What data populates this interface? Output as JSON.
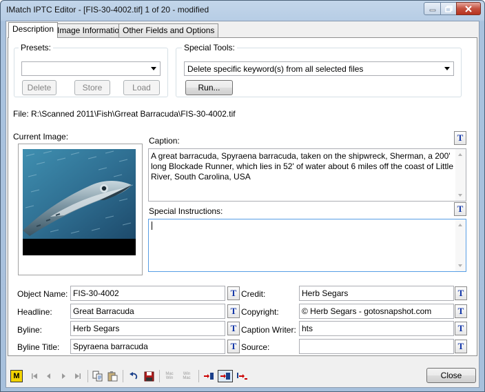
{
  "window": {
    "title": "IMatch IPTC Editor - [FIS-30-4002.tif]  1 of 20 - modified"
  },
  "tabs": [
    {
      "label": "Description"
    },
    {
      "label": "Image Information"
    },
    {
      "label": "Other Fields and Options"
    }
  ],
  "presets": {
    "label": "Presets:",
    "value": "",
    "delete_label": "Delete",
    "store_label": "Store",
    "load_label": "Load"
  },
  "special_tools": {
    "label": "Special Tools:",
    "selected": "Delete specific keyword(s) from all selected files",
    "run_label": "Run..."
  },
  "file_path": "File: R:\\Scanned 2011\\Fish\\Grreat Barracuda\\FIS-30-4002.tif",
  "current_image_label": "Current Image:",
  "caption": {
    "label": "Caption:",
    "text": "A great barracuda, Spyraena barracuda, taken on the shipwreck, Sherman, a 200' long Blockade Runner, which lies in 52' of water about 6 miles off the coast of Little River, South Carolina, USA"
  },
  "special_instructions": {
    "label": "Special Instructions:",
    "text": ""
  },
  "fields_left": [
    {
      "label": "Object Name:",
      "value": "FIS-30-4002"
    },
    {
      "label": "Headline:",
      "value": "Great Barracuda"
    },
    {
      "label": "Byline:",
      "value": "Herb Segars"
    },
    {
      "label": "Byline Title:",
      "value": "Spyraena barracuda"
    }
  ],
  "fields_right": [
    {
      "label": "Credit:",
      "value": "Herb Segars"
    },
    {
      "label": "Copyright:",
      "value": "© Herb Segars - gotosnapshot.com"
    },
    {
      "label": "Caption Writer:",
      "value": "hts"
    },
    {
      "label": "Source:",
      "value": ""
    }
  ],
  "template_button_glyph": "T",
  "toolbar": {
    "m_label": "M",
    "mac_win_label": "Mac Win",
    "win_mac_label": "Win Mac",
    "close_label": "Close"
  }
}
